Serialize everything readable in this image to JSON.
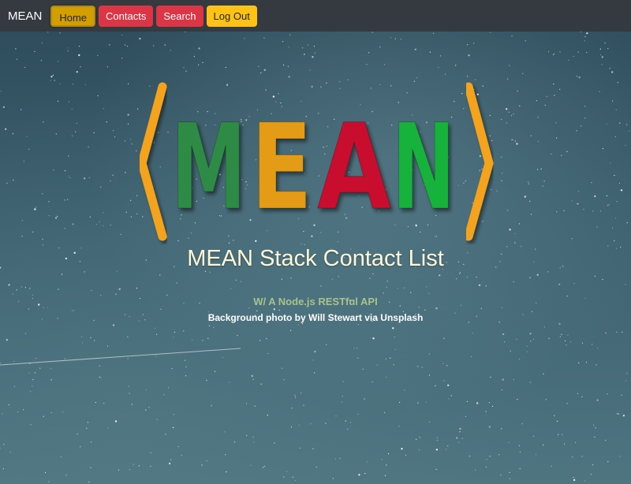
{
  "nav": {
    "brand": "MEAN",
    "buttons": [
      {
        "label": "Home",
        "style": "warning",
        "active": true
      },
      {
        "label": "Contacts",
        "style": "danger"
      },
      {
        "label": "Search",
        "style": "danger"
      },
      {
        "label": "Log Out",
        "style": "warning"
      }
    ]
  },
  "hero": {
    "logo": {
      "letters": [
        "M",
        "E",
        "A",
        "N"
      ],
      "letter_colors": [
        "#2e8b44",
        "#e49b14",
        "#c8102e",
        "#13b23a"
      ],
      "bracket_color": "#f5a31a"
    },
    "title": "MEAN Stack Contact List",
    "subtitle": "W/ A Node.js RESTful API",
    "credit": "Background photo by Will Stewart via Unsplash"
  },
  "colors": {
    "navbar_bg": "#343a40",
    "warning": "#fdc314",
    "danger": "#dc3545"
  }
}
